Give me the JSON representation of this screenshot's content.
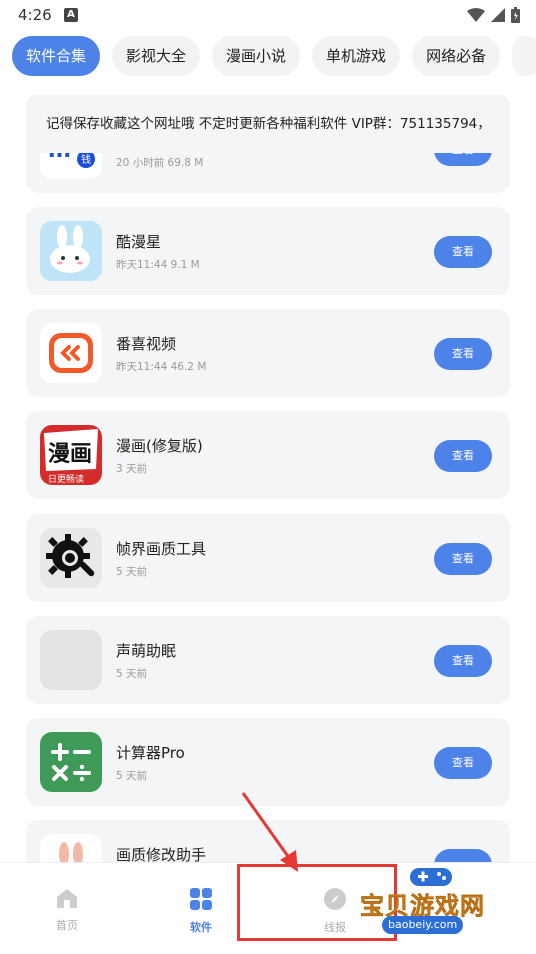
{
  "status_bar": {
    "time": "4:26",
    "badge": "A"
  },
  "tabs": [
    {
      "label": "软件合集"
    },
    {
      "label": "影视大全"
    },
    {
      "label": "漫画小说"
    },
    {
      "label": "单机游戏"
    },
    {
      "label": "网络必备"
    },
    {
      "label": ""
    }
  ],
  "notice": {
    "text": "记得保存收藏这个网址哦 不定时更新各种福利软件 VIP群：751135794，"
  },
  "apps": [
    {
      "name": "",
      "meta": "20 小时前  69.8 M",
      "button": "查看",
      "icon": "mi-app-icon"
    },
    {
      "name": "酷漫星",
      "meta": "昨天11:44  9.1 M",
      "button": "查看",
      "icon": "rabbit-icon"
    },
    {
      "name": "番喜视频",
      "meta": "昨天11:44  46.2 M",
      "button": "查看",
      "icon": "video-play-icon"
    },
    {
      "name": "漫画(修复版)",
      "meta": "3 天前",
      "button": "查看",
      "icon": "manhua-icon"
    },
    {
      "name": "帧界画质工具",
      "meta": "5 天前",
      "button": "查看",
      "icon": "gear-search-icon"
    },
    {
      "name": "声萌助眠",
      "meta": "5 天前",
      "button": "查看",
      "icon": "placeholder-icon"
    },
    {
      "name": "计算器Pro",
      "meta": "5 天前",
      "button": "查看",
      "icon": "calculator-icon"
    },
    {
      "name": "画质修改助手",
      "meta": "",
      "button": "",
      "icon": "rabbit-ears-icon"
    }
  ],
  "bottom_nav": [
    {
      "label": "首页",
      "icon": "home-icon"
    },
    {
      "label": "软件",
      "icon": "grid-icon"
    },
    {
      "label": "线报",
      "icon": "compass-icon"
    }
  ],
  "watermark": {
    "text": "宝贝游戏网",
    "url": "baobeiy.com"
  },
  "colors": {
    "accent": "#4d82e8",
    "card_bg": "#f4f5f7",
    "annotation": "#e53935"
  }
}
